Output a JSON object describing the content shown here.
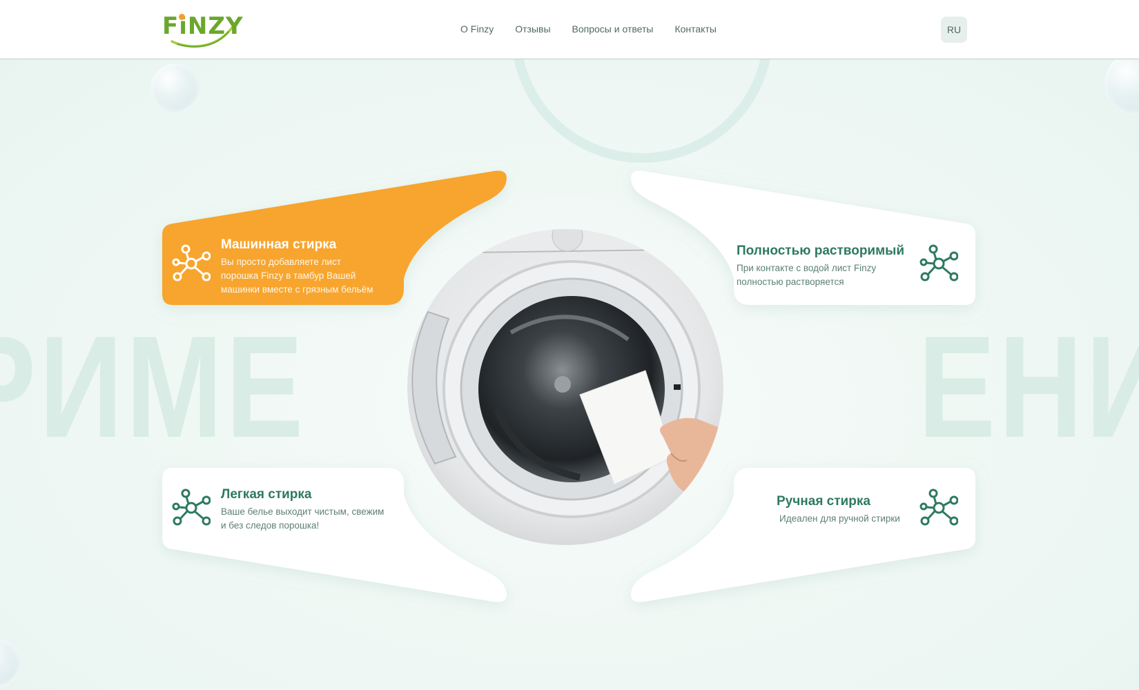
{
  "brand": {
    "logo_text": "FiNZY"
  },
  "nav": {
    "items": [
      {
        "label": "О Finzy"
      },
      {
        "label": "Отзывы"
      },
      {
        "label": "Вопросы и ответы"
      },
      {
        "label": "Контакты"
      }
    ]
  },
  "language": {
    "current": "RU"
  },
  "background_words": {
    "left": "РИМЕ",
    "right": "ЕНИ"
  },
  "colors": {
    "accent": "#f7a52e",
    "primary_green": "#2d7a5f",
    "logo_green": "#6aa72c"
  },
  "features": {
    "machine": {
      "title": "Машинная стирка",
      "desc_lines": [
        "Вы просто добавляете лист",
        "порошка Finzy в тамбур Вашей",
        "машинки вместе с грязным бельём"
      ],
      "icon": "molecule-icon"
    },
    "soluble": {
      "title": "Полностью растворимый",
      "desc_lines": [
        "При контакте с водой лист Finzy",
        "полностью растворяется"
      ],
      "icon": "molecule-icon"
    },
    "easy": {
      "title": "Легкая стирка",
      "desc_lines": [
        "Ваше белье выходит чистым, свежим",
        "и без следов порошка!"
      ],
      "icon": "molecule-icon"
    },
    "hand": {
      "title": "Ручная стирка",
      "desc_lines": [
        "Идеален для ручной стирки"
      ],
      "icon": "molecule-icon"
    }
  },
  "center_image": {
    "subject": "washing-machine-with-detergent-sheet"
  }
}
